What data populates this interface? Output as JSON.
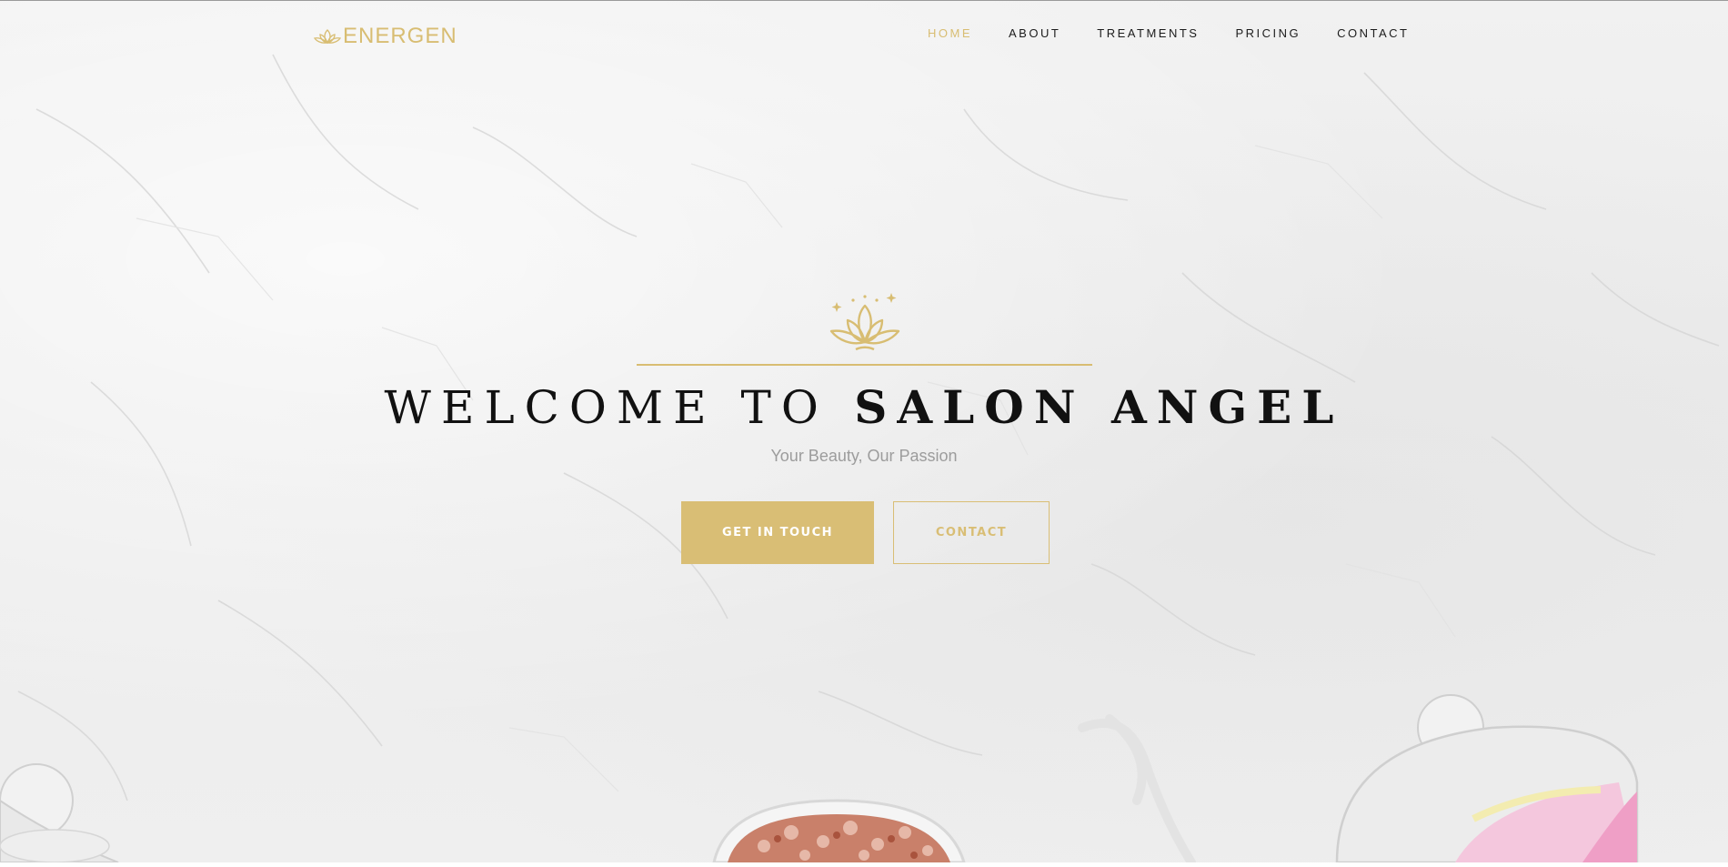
{
  "brand": {
    "name": "ENERGEN",
    "icon": "lotus-icon"
  },
  "nav": {
    "items": [
      {
        "label": "HOME",
        "active": true
      },
      {
        "label": "ABOUT",
        "active": false
      },
      {
        "label": "TREATMENTS",
        "active": false
      },
      {
        "label": "PRICING",
        "active": false
      },
      {
        "label": "CONTACT",
        "active": false
      }
    ]
  },
  "hero": {
    "icon": "lotus-icon",
    "title_light": "WELCOME TO",
    "title_bold": "SALON ANGEL",
    "subtitle": "Your Beauty, Our Passion",
    "primary_button": "GET IN TOUCH",
    "secondary_button": "CONTACT"
  },
  "colors": {
    "accent": "#d9be75",
    "text": "#111111",
    "subtitle": "#9c9c9c"
  }
}
